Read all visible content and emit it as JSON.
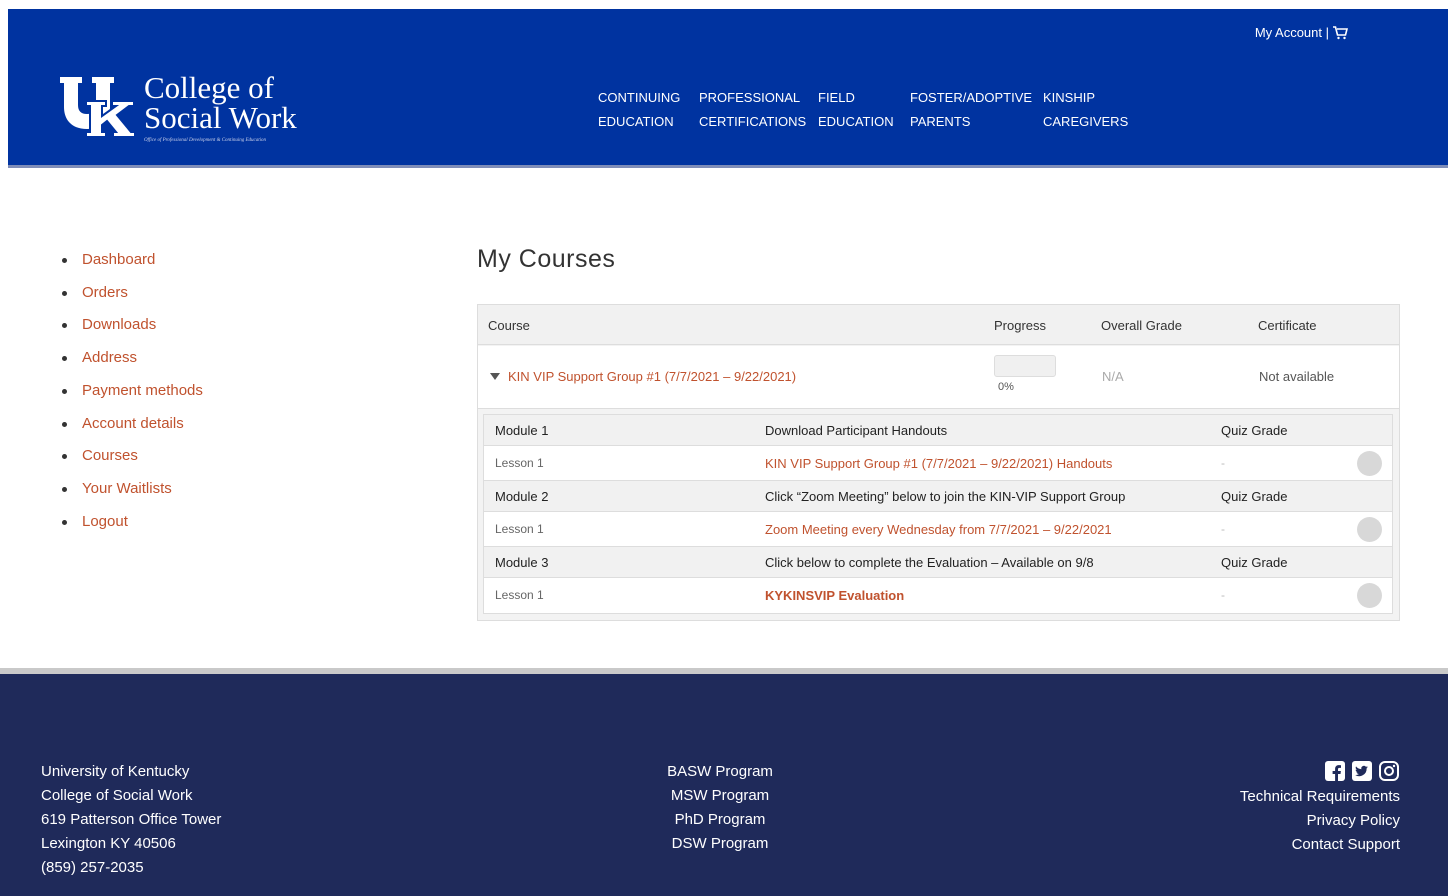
{
  "header": {
    "account_label": "My Account |",
    "logo_title_line1": "College of",
    "logo_title_line2": "Social Work",
    "logo_subtitle": "Office of Professional Development & Continuing Education",
    "nav": [
      {
        "line1": "CONTINUING",
        "line2": "EDUCATION"
      },
      {
        "line1": "PROFESSIONAL",
        "line2": "CERTIFICATIONS"
      },
      {
        "line1": "FIELD",
        "line2": "EDUCATION"
      },
      {
        "line1": "FOSTER/ADOPTIVE",
        "line2": "PARENTS"
      },
      {
        "line1": "KINSHIP",
        "line2": "CAREGIVERS"
      }
    ]
  },
  "sidebar": {
    "items": [
      "Dashboard",
      "Orders",
      "Downloads",
      "Address",
      "Payment methods",
      "Account details",
      "Courses",
      "Your Waitlists",
      "Logout"
    ]
  },
  "main": {
    "title": "My Courses",
    "columns": {
      "course": "Course",
      "progress": "Progress",
      "grade": "Overall Grade",
      "certificate": "Certificate"
    },
    "course": {
      "name": "KIN VIP Support Group #1 (7/7/2021 – 9/22/2021)",
      "progress_percent": 0,
      "progress_text": "0%",
      "grade": "N/A",
      "certificate": "Not available"
    },
    "modules": [
      {
        "module": "Module 1",
        "title": "Download Participant Handouts",
        "grade_label": "Quiz Grade",
        "lesson": "Lesson 1",
        "lesson_title": "KIN VIP Support Group #1 (7/7/2021 – 9/22/2021) Handouts",
        "lesson_grade": "-"
      },
      {
        "module": "Module 2",
        "title": "Click “Zoom Meeting” below to join the KIN-VIP Support Group",
        "grade_label": "Quiz Grade",
        "lesson": "Lesson 1",
        "lesson_title": "Zoom Meeting every Wednesday from 7/7/2021 – 9/22/2021",
        "lesson_grade": "-"
      },
      {
        "module": "Module 3",
        "title": "Click below to complete the Evaluation – Available on 9/8",
        "grade_label": "Quiz Grade",
        "lesson": "Lesson 1",
        "lesson_title": "KYKINSVIP Evaluation",
        "lesson_grade": "-"
      }
    ]
  },
  "footer": {
    "address": [
      "University of Kentucky",
      "College of Social Work",
      "619 Patterson Office Tower",
      "Lexington KY 40506",
      "(859) 257-2035"
    ],
    "programs": [
      "BASW Program",
      "MSW Program",
      "PhD Program",
      "DSW Program"
    ],
    "links": [
      "Technical Requirements",
      "Privacy Policy",
      "Contact Support"
    ],
    "social_icons": [
      "facebook-icon",
      "twitter-icon",
      "instagram-icon"
    ]
  },
  "colors": {
    "header_blue": "#0033a0",
    "footer_navy": "#1f2a5a",
    "link_orange": "#c0522e"
  }
}
